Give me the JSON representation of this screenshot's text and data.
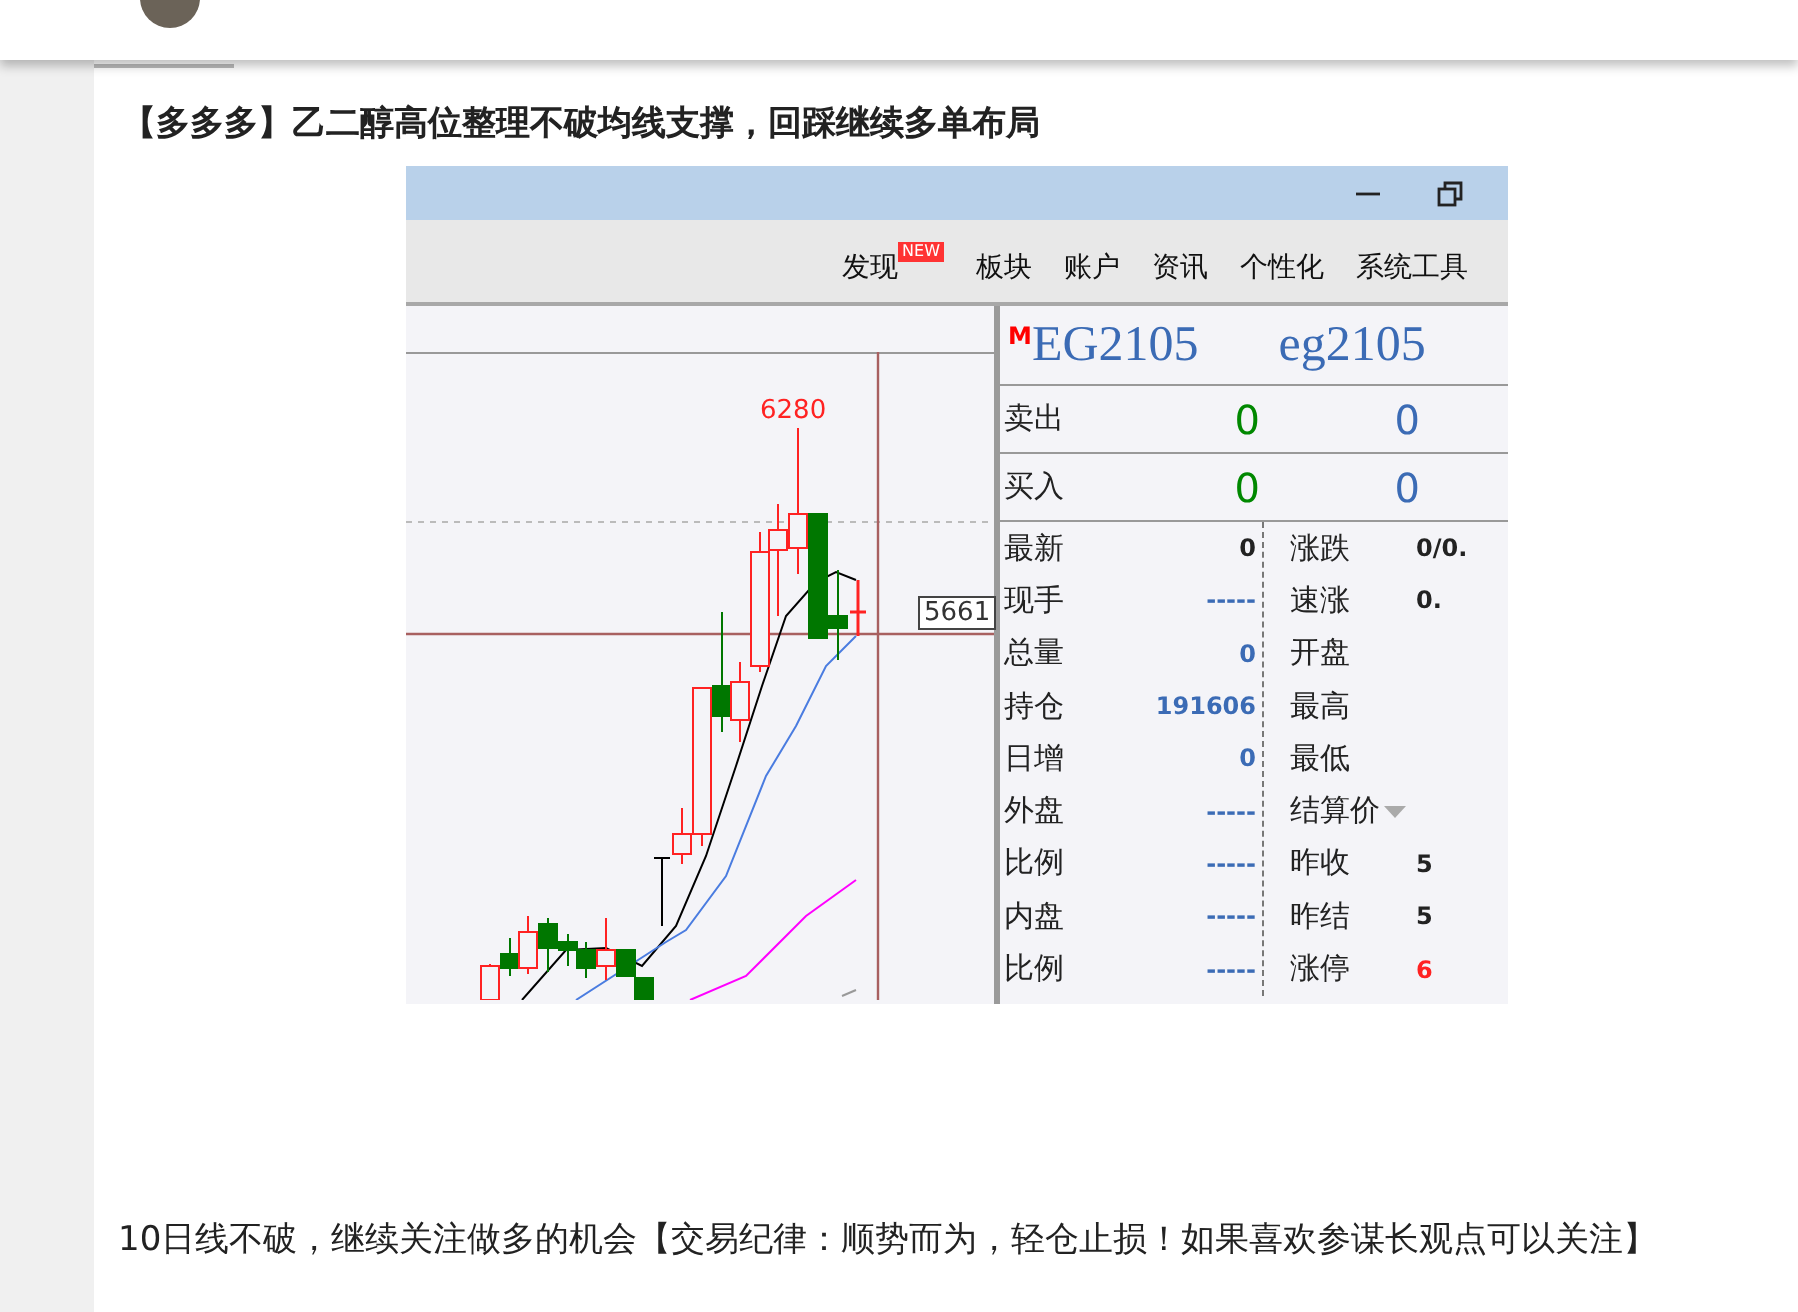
{
  "post": {
    "title": "【多多多】乙二醇高位整理不破均线支撑，回踩继续多单布局",
    "screenshot": {
      "menu": [
        {
          "label": "发现",
          "badge": "NEW"
        },
        {
          "label": "板块"
        },
        {
          "label": "账户"
        },
        {
          "label": "资讯"
        },
        {
          "label": "个性化"
        },
        {
          "label": "系统工具"
        }
      ],
      "chart": {
        "high_label": "6280",
        "price_label": "5661"
      },
      "quote": {
        "market_mark": "M",
        "code": "EG2105",
        "code_lower": "eg2105",
        "book": [
          {
            "label": "卖出",
            "volume": "0",
            "count": "0"
          },
          {
            "label": "买入",
            "volume": "0",
            "count": "0"
          }
        ],
        "rows": [
          {
            "left": {
              "label": "最新",
              "value": "0",
              "kind": "price"
            },
            "right": {
              "label": "涨跌",
              "value": "0/0.",
              "kind": "price"
            }
          },
          {
            "left": {
              "label": "现手",
              "value": "-----",
              "kind": "volume"
            },
            "right": {
              "label": "速涨",
              "value": "0.",
              "kind": "price"
            }
          },
          {
            "left": {
              "label": "总量",
              "value": "0",
              "kind": "volume"
            },
            "right": {
              "label": "开盘"
            }
          },
          {
            "left": {
              "label": "持仓",
              "value": "191606",
              "kind": "volume"
            },
            "right": {
              "label": "最高"
            }
          },
          {
            "left": {
              "label": "日增",
              "value": "0",
              "kind": "volume"
            },
            "right": {
              "label": "最低"
            }
          },
          {
            "left": {
              "label": "外盘",
              "value": "-----",
              "kind": "volume"
            },
            "right": {
              "label": "结算价",
              "kind": "dropdown"
            }
          },
          {
            "left": {
              "label": "比例",
              "value": "-----",
              "kind": "volume"
            },
            "right": {
              "label": "昨收",
              "value": "5",
              "kind": "price"
            }
          },
          {
            "left": {
              "label": "内盘",
              "value": "-----",
              "kind": "volume"
            },
            "right": {
              "label": "昨结",
              "value": "5",
              "kind": "price"
            }
          },
          {
            "left": {
              "label": "比例",
              "value": "-----",
              "kind": "volume"
            },
            "right": {
              "label": "涨停",
              "value": "6",
              "kind": "limit"
            }
          }
        ]
      }
    },
    "body": "10日线不破，继续关注做多的机会【交易纪律：顺势而为，轻仓止损！如果喜欢参谋长观点可以关注】"
  }
}
